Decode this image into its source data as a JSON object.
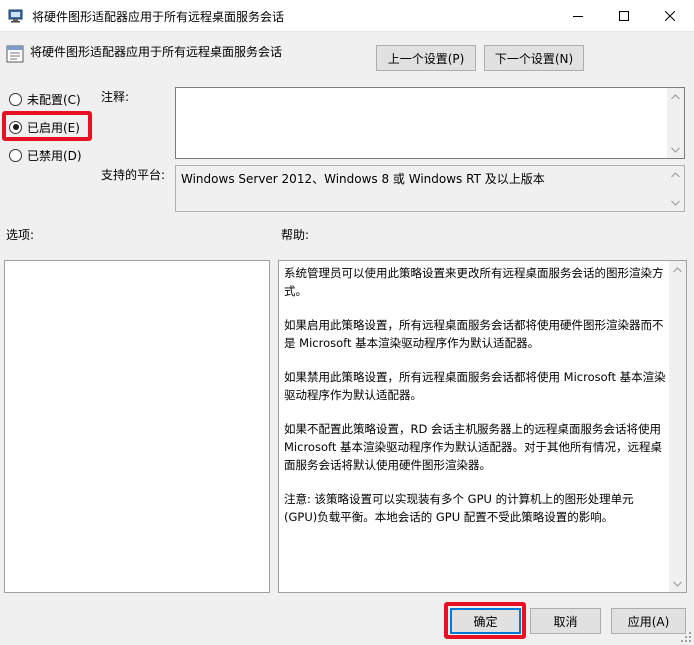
{
  "window": {
    "title": "将硬件图形适配器应用于所有远程桌面服务会话",
    "controls": {
      "minimize": "minimize-icon",
      "maximize": "maximize-icon",
      "close": "close-icon"
    }
  },
  "header": {
    "policy_title": "将硬件图形适配器应用于所有远程桌面服务会话",
    "prev_button": "上一个设置(P)",
    "next_button": "下一个设置(N)"
  },
  "state": {
    "options": [
      {
        "label": "未配置(C)",
        "checked": false
      },
      {
        "label": "已启用(E)",
        "checked": true
      },
      {
        "label": "已禁用(D)",
        "checked": false
      }
    ]
  },
  "comment": {
    "label": "注释:",
    "value": ""
  },
  "platform": {
    "label": "支持的平台:",
    "value": "Windows Server 2012、Windows 8 或 Windows RT 及以上版本"
  },
  "options_pane": {
    "label": "选项:"
  },
  "help_pane": {
    "label": "帮助:",
    "paragraphs": [
      "系统管理员可以使用此策略设置来更改所有远程桌面服务会话的图形渲染方式。",
      "如果启用此策略设置，所有远程桌面服务会话都将使用硬件图形渲染器而不是 Microsoft 基本渲染驱动程序作为默认适配器。",
      "如果禁用此策略设置，所有远程桌面服务会话都将使用 Microsoft 基本渲染驱动程序作为默认适配器。",
      "如果不配置此策略设置，RD 会话主机服务器上的远程桌面服务会话将使用 Microsoft 基本渲染驱动程序作为默认适配器。对于其他所有情况，远程桌面服务会话将默认使用硬件图形渲染器。",
      "注意: 该策略设置可以实现装有多个 GPU 的计算机上的图形处理单元(GPU)负载平衡。本地会话的 GPU 配置不受此策略设置的影响。"
    ]
  },
  "footer": {
    "ok": "确定",
    "cancel": "取消",
    "apply": "应用(A)"
  },
  "colors": {
    "highlight": "#e81123",
    "window_bg": "#f0f0f0",
    "button_bg": "#e1e1e1"
  }
}
